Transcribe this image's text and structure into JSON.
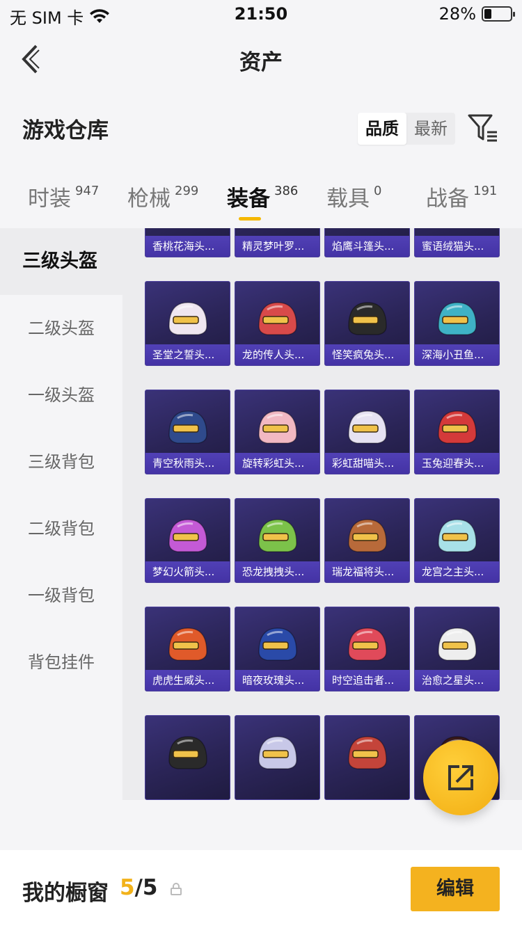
{
  "status_bar": {
    "carrier": "无 SIM 卡",
    "time": "21:50",
    "battery": "28%",
    "battery_level": 0.28
  },
  "nav": {
    "title": "资产"
  },
  "warehouse": {
    "title": "游戏仓库",
    "sort_options": [
      "品质",
      "最新"
    ],
    "sort_selected": "品质"
  },
  "tabs": [
    {
      "label": "时装",
      "count": "947"
    },
    {
      "label": "枪械",
      "count": "299"
    },
    {
      "label": "装备",
      "count": "386",
      "active": true
    },
    {
      "label": "载具",
      "count": "0"
    },
    {
      "label": "战备",
      "count": "191"
    }
  ],
  "sidebar": {
    "items": [
      {
        "label": "三级头盔",
        "active": true
      },
      {
        "label": "二级头盔"
      },
      {
        "label": "一级头盔"
      },
      {
        "label": "三级背包"
      },
      {
        "label": "二级背包"
      },
      {
        "label": "一级背包"
      },
      {
        "label": "背包挂件"
      }
    ]
  },
  "items": [
    {
      "name": "香桃花海头...",
      "color": "#e8a7c3"
    },
    {
      "name": "精灵梦叶罗...",
      "color": "#e9e4d6"
    },
    {
      "name": "焰鹰斗篷头...",
      "color": "#7a2a2a"
    },
    {
      "name": "蜜语绒猫头...",
      "color": "#e6b8a0"
    },
    {
      "name": "圣堂之誓头...",
      "color": "#efe6f0"
    },
    {
      "name": "龙的传人头...",
      "color": "#d84a4a"
    },
    {
      "name": "怪笑疯兔头...",
      "color": "#2a2a2a"
    },
    {
      "name": "深海小丑鱼...",
      "color": "#3fb2c6"
    },
    {
      "name": "青空秋雨头...",
      "color": "#2f4a8c"
    },
    {
      "name": "旋转彩虹头...",
      "color": "#f2b8c2"
    },
    {
      "name": "彩虹甜喵头...",
      "color": "#e6e2f2"
    },
    {
      "name": "玉兔迎春头...",
      "color": "#d43a3a"
    },
    {
      "name": "梦幻火箭头...",
      "color": "#c45ad6"
    },
    {
      "name": "恐龙拽拽头...",
      "color": "#7cc24a"
    },
    {
      "name": "瑞龙福将头...",
      "color": "#b86a3a"
    },
    {
      "name": "龙宫之主头...",
      "color": "#a8e0e8"
    },
    {
      "name": "虎虎生威头...",
      "color": "#e05a2a"
    },
    {
      "name": "暗夜玫瑰头...",
      "color": "#2a4aa8"
    },
    {
      "name": "时空追击者...",
      "color": "#e04a5a"
    },
    {
      "name": "治愈之星头...",
      "color": "#eeeeee"
    },
    {
      "name": "",
      "color": "#2a2a2a"
    },
    {
      "name": "",
      "color": "#c8c8e8"
    },
    {
      "name": "",
      "color": "#c4443a"
    },
    {
      "name": "",
      "color": "#3a1a1a"
    }
  ],
  "showcase": {
    "label": "我的橱窗",
    "current": "5",
    "separator": "/",
    "total": "5"
  },
  "edit_button": "编辑",
  "colors": {
    "accent": "#f4b21f",
    "card_bg": "#2a2456",
    "card_label_bg": "#5846c8"
  }
}
